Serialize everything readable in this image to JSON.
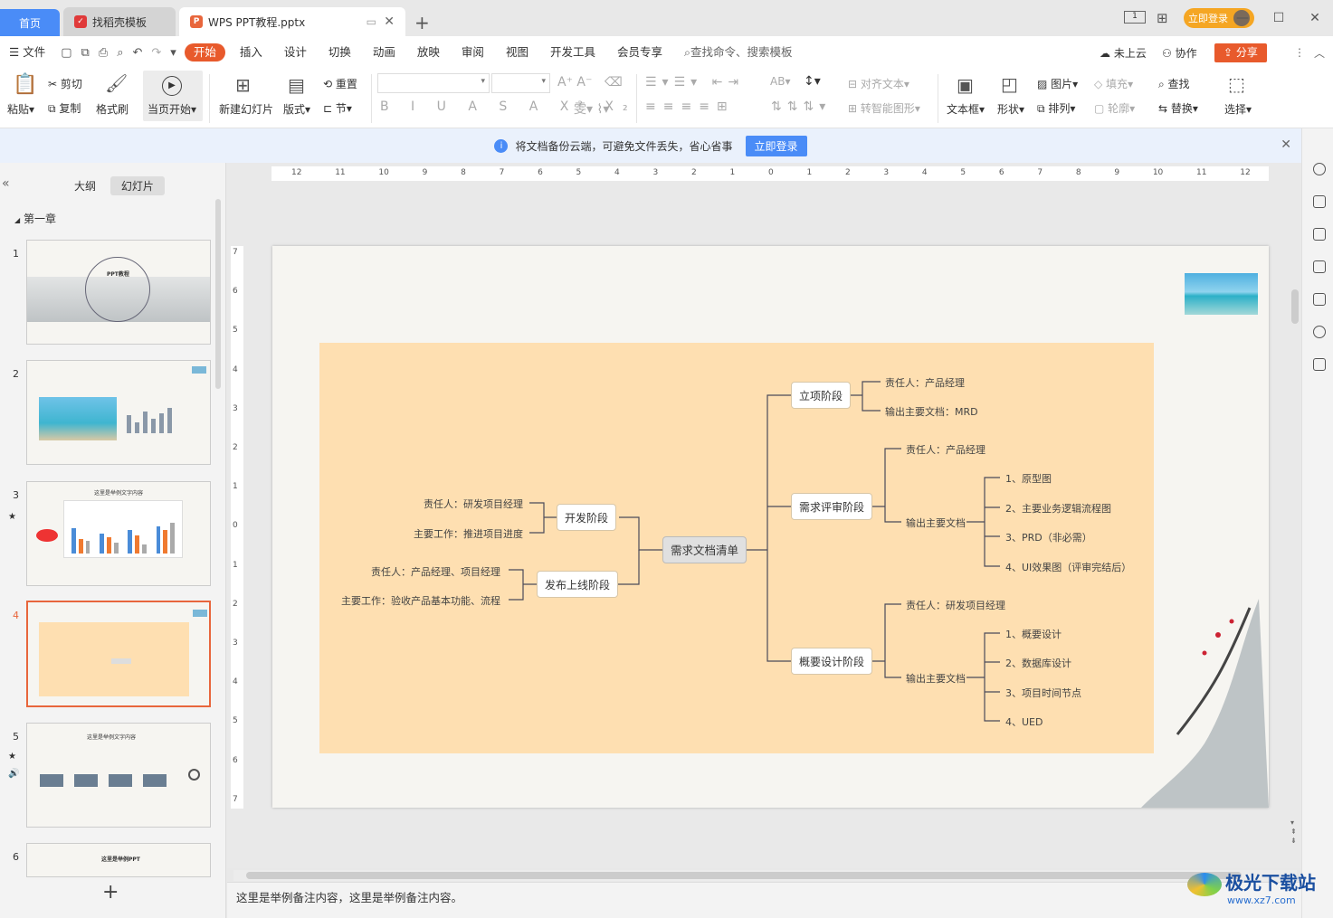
{
  "tabs": {
    "home": "首页",
    "daoke": "找稻壳模板",
    "file": "WPS PPT教程.pptx"
  },
  "titlebar": {
    "login": "立即登录"
  },
  "menu": {
    "file": "文件",
    "items": [
      "开始",
      "插入",
      "设计",
      "切换",
      "动画",
      "放映",
      "审阅",
      "视图",
      "开发工具",
      "会员专享"
    ],
    "search": "查找命令、搜索模板",
    "cloud": "未上云",
    "collab": "协作",
    "share": "分享"
  },
  "ribbon": {
    "paste": "粘贴",
    "cut": "剪切",
    "copy": "复制",
    "format_painter": "格式刷",
    "play_from": "当页开始",
    "new_slide": "新建幻灯片",
    "layout": "版式",
    "reset": "重置",
    "section": "节",
    "align_text": "对齐文本",
    "smart_shape": "转智能图形",
    "textbox": "文本框",
    "shape": "形状",
    "picture": "图片",
    "fill": "填充",
    "arrange": "排列",
    "outline": "轮廓",
    "find": "查找",
    "replace": "替换",
    "select": "选择"
  },
  "notify": {
    "text": "将文档备份云端，可避免文件丢失，省心省事",
    "login": "立即登录"
  },
  "leftpanel": {
    "tab_outline": "大纲",
    "tab_slides": "幻灯片",
    "chapter": "第一章",
    "slide_numbers": [
      "1",
      "2",
      "3",
      "4",
      "5",
      "6"
    ],
    "thumb1_title": "PPT教程",
    "thumb3_title": "这里是举例文字内容",
    "thumb5_title": "这里是举例文字内容",
    "thumb6_title": "这里是举例PPT"
  },
  "ruler": {
    "h_ticks": [
      "12",
      "11",
      "10",
      "9",
      "8",
      "7",
      "6",
      "5",
      "4",
      "3",
      "2",
      "1",
      "0",
      "1",
      "2",
      "3",
      "4",
      "5",
      "6",
      "7",
      "8",
      "9",
      "10",
      "11",
      "12"
    ],
    "v_ticks": [
      "7",
      "6",
      "5",
      "4",
      "3",
      "2",
      "1",
      "0",
      "1",
      "2",
      "3",
      "4",
      "5",
      "6",
      "7"
    ]
  },
  "mindmap": {
    "central": "需求文档清单",
    "left": [
      {
        "label": "开发阶段",
        "leaves": [
          "责任人：研发项目经理",
          "主要工作：推进项目进度"
        ]
      },
      {
        "label": "发布上线阶段",
        "leaves": [
          "责任人：产品经理、项目经理",
          "主要工作：验收产品基本功能、流程"
        ]
      }
    ],
    "right": [
      {
        "label": "立项阶段",
        "leaves": [
          "责任人：产品经理",
          "输出主要文档：MRD"
        ]
      },
      {
        "label": "需求评审阶段",
        "owner": "责任人：产品经理",
        "doc": "输出主要文档",
        "items": [
          "1、原型图",
          "2、主要业务逻辑流程图",
          "3、PRD（非必需）",
          "4、UI效果图（评审完结后）"
        ]
      },
      {
        "label": "概要设计阶段",
        "owner": "责任人：研发项目经理",
        "doc": "输出主要文档",
        "items": [
          "1、概要设计",
          "2、数据库设计",
          "3、项目时间节点",
          "4、UED"
        ]
      }
    ]
  },
  "notes": "这里是举例备注内容，这里是举例备注内容。",
  "watermark": {
    "name": "极光下载站",
    "url": "www.xz7.com"
  },
  "colors": {
    "accent": "#e85a2c",
    "blue": "#4a8cf7",
    "map_bg": "#fedfb1"
  }
}
